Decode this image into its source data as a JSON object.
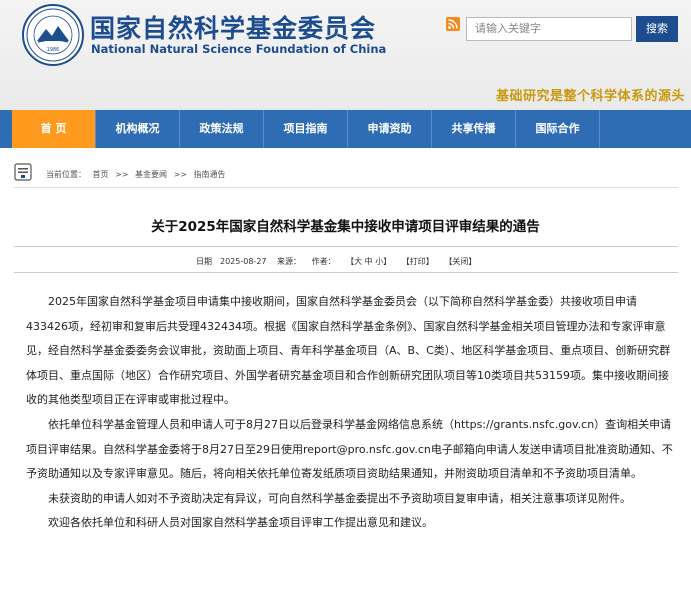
{
  "header": {
    "logo_year": "1986",
    "site_name_cn": "国家自然科学基金委员会",
    "site_name_en": "National Natural Science Foundation of China",
    "search_placeholder": "请输入关键字",
    "search_button": "搜索",
    "slogan": "基础研究是整个科学体系的源头"
  },
  "nav": {
    "items": [
      "首 页",
      "机构概况",
      "政策法规",
      "项目指南",
      "申请资助",
      "共享传播",
      "国际合作"
    ]
  },
  "breadcrumb": {
    "label": "当前位置：",
    "items": [
      "首页",
      "基金要闻",
      "指南通告"
    ],
    "separator": ">>"
  },
  "article": {
    "title": "关于2025年国家自然科学基金集中接收申请项目评审结果的通告",
    "date_label": "日期",
    "date": "2025-08-27",
    "source_label": "来源：",
    "author_label": "作者：",
    "font_size": "【大 中 小】",
    "print": "【打印】",
    "close": "【关闭】",
    "paragraphs": [
      "2025年国家自然科学基金项目申请集中接收期间，国家自然科学基金委员会（以下简称自然科学基金委）共接收项目申请433426项，经初审和复审后共受理432434项。根据《国家自然科学基金条例》、国家自然科学基金相关项目管理办法和专家评审意见，经自然科学基金委委务会议审批，资助面上项目、青年科学基金项目（A、B、C类）、地区科学基金项目、重点项目、创新研究群体项目、重点国际（地区）合作研究项目、外国学者研究基金项目和合作创新研究团队项目等10类项目共53159项。集中接收期间接收的其他类型项目正在评审或审批过程中。",
      "依托单位科学基金管理人员和申请人可于8月27日以后登录科学基金网络信息系统（https://grants.nsfc.gov.cn）查询相关申请项目评审结果。自然科学基金委将于8月27日至29日使用report@pro.nsfc.gov.cn电子邮箱向申请人发送申请项目批准资助通知、不予资助通知以及专家评审意见。随后，将向相关依托单位寄发纸质项目资助结果通知，并附资助项目清单和不予资助项目清单。",
      "未获资助的申请人如对不予资助决定有异议，可向自然科学基金委提出不予资助项目复审申请，相关注意事项详见附件。",
      "欢迎各依托单位和科研人员对国家自然科学基金项目评审工作提出意见和建议。"
    ]
  },
  "colors": {
    "brand_blue": "#1d4d8f",
    "nav_blue": "#2e6db3",
    "nav_active": "#ff9a1f",
    "slogan_gold": "#c99a10"
  }
}
